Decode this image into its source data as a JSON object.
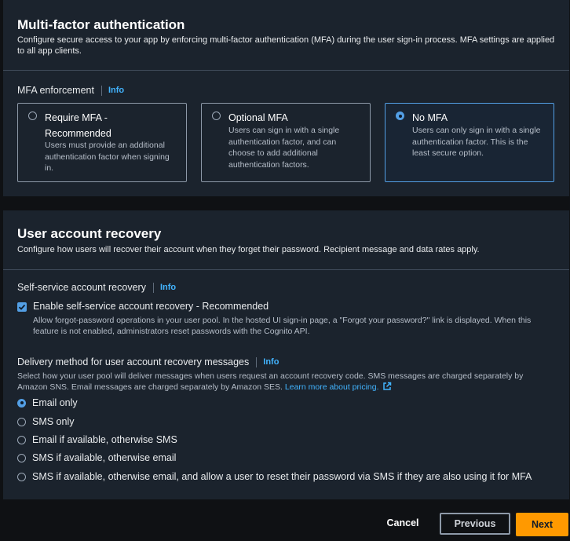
{
  "mfa": {
    "title": "Multi-factor authentication",
    "description": "Configure secure access to your app by enforcing multi-factor authentication (MFA) during the user sign-in process. MFA settings are applied to all app clients.",
    "enforcement_label": "MFA enforcement",
    "info": "Info",
    "options": [
      {
        "title": "Require MFA - Recommended",
        "desc": "Users must provide an additional authentication factor when signing in.",
        "selected": false
      },
      {
        "title": "Optional MFA",
        "desc": "Users can sign in with a single authentication factor, and can choose to add additional authentication factors.",
        "selected": false
      },
      {
        "title": "No MFA",
        "desc": "Users can only sign in with a single authentication factor. This is the least secure option.",
        "selected": true
      }
    ]
  },
  "recovery": {
    "title": "User account recovery",
    "description": "Configure how users will recover their account when they forget their password. Recipient message and data rates apply.",
    "self_service_label": "Self-service account recovery",
    "info": "Info",
    "checkbox_label": "Enable self-service account recovery - Recommended",
    "checkbox_checked": true,
    "checkbox_desc": "Allow forgot-password operations in your user pool. In the hosted UI sign-in page, a \"Forgot your password?\" link is displayed. When this feature is not enabled, administrators reset passwords with the Cognito API.",
    "delivery_label": "Delivery method for user account recovery messages",
    "delivery_desc": "Select how your user pool will deliver messages when users request an account recovery code. SMS messages are charged separately by Amazon SNS. Email messages are charged separately by Amazon SES.",
    "pricing_link": "Learn more about pricing.",
    "delivery_options": [
      {
        "label": "Email only",
        "selected": true
      },
      {
        "label": "SMS only",
        "selected": false
      },
      {
        "label": "Email if available, otherwise SMS",
        "selected": false
      },
      {
        "label": "SMS if available, otherwise email",
        "selected": false
      },
      {
        "label": "SMS if available, otherwise email, and allow a user to reset their password via SMS if they are also using it for MFA",
        "selected": false
      }
    ]
  },
  "footer": {
    "cancel": "Cancel",
    "previous": "Previous",
    "next": "Next"
  },
  "colors": {
    "accent": "#539fe5",
    "primary_button": "#ff9900",
    "link": "#42b4ff"
  }
}
